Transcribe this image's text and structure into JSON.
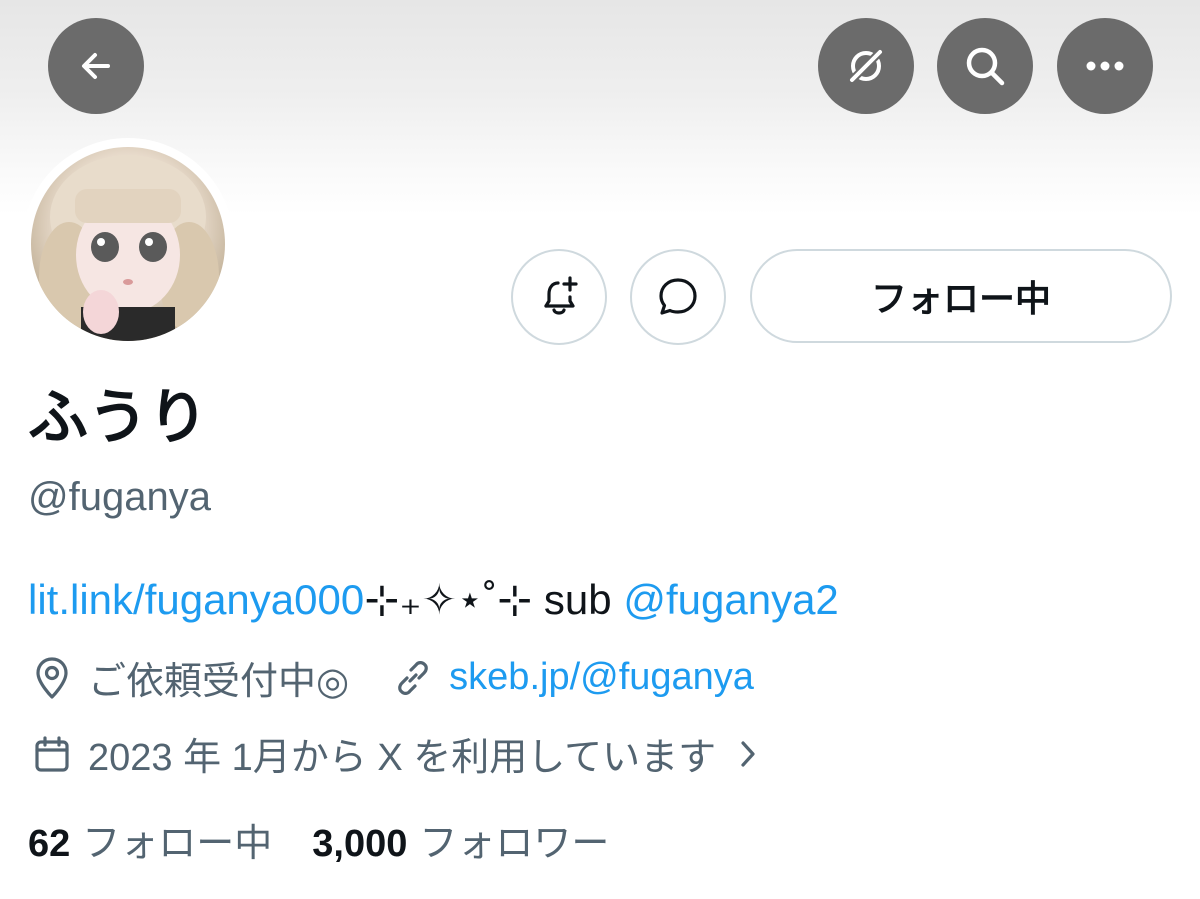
{
  "header": {
    "back_icon": "arrow-left-icon",
    "grok_icon": "grok-icon",
    "search_icon": "search-icon",
    "more_icon": "more-icon"
  },
  "actions": {
    "notify_icon": "bell-plus-icon",
    "message_icon": "message-icon",
    "follow_label": "フォロー中"
  },
  "profile": {
    "display_name": "ふうり",
    "handle": "@fuganya",
    "bio": {
      "link": "lit.link/fuganya000",
      "deco": "⊹₊✧⋆˚⊹",
      "sub_text": " sub ",
      "mention": "@fuganya2"
    },
    "location": "ご依頼受付中◎",
    "website": "skeb.jp/@fuganya",
    "joined": "2023 年 1月から X を利用しています"
  },
  "stats": {
    "following_count": "62",
    "following_label": "フォロー中",
    "followers_count": "3,000",
    "followers_label": "フォロワー"
  },
  "colors": {
    "link": "#1d9bf0",
    "muted": "#536471",
    "border": "#cfd9de",
    "circle_btn": "#6b6b6b"
  }
}
